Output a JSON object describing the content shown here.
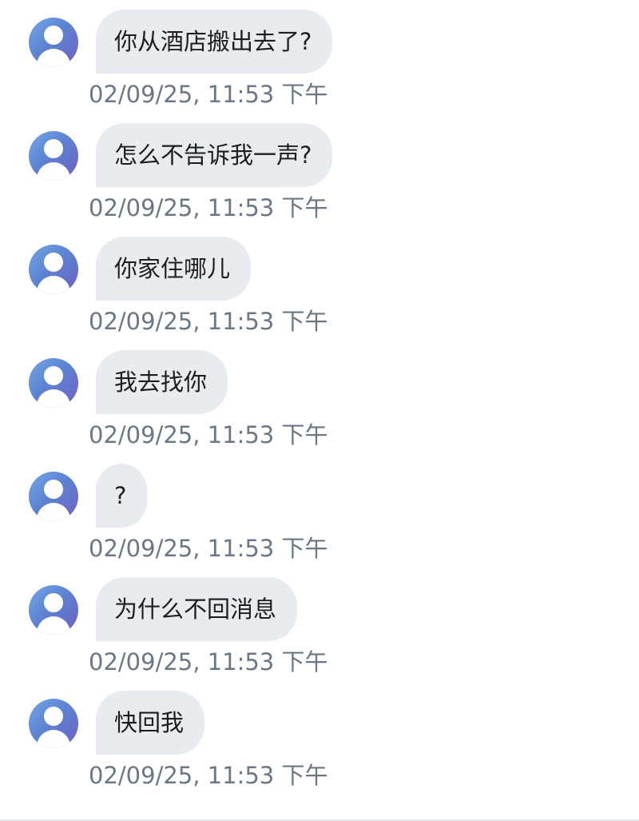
{
  "messages": [
    {
      "text": "你从酒店搬出去了?",
      "time": "02/09/25, 11:53 下午"
    },
    {
      "text": "怎么不告诉我一声?",
      "time": "02/09/25, 11:53 下午"
    },
    {
      "text": "你家住哪儿",
      "time": "02/09/25, 11:53 下午"
    },
    {
      "text": "我去找你",
      "time": "02/09/25, 11:53 下午"
    },
    {
      "text": "?",
      "time": "02/09/25, 11:53 下午"
    },
    {
      "text": "为什么不回消息",
      "time": "02/09/25, 11:53 下午"
    },
    {
      "text": "快回我",
      "time": "02/09/25, 11:53 下午"
    }
  ],
  "icons": {
    "avatar": "user-avatar-icon"
  },
  "colors": {
    "bubble_bg": "#e8ecf0",
    "timestamp": "#6b7784",
    "avatar_gradient": [
      "#74a6e6",
      "#6f5fc4"
    ]
  }
}
